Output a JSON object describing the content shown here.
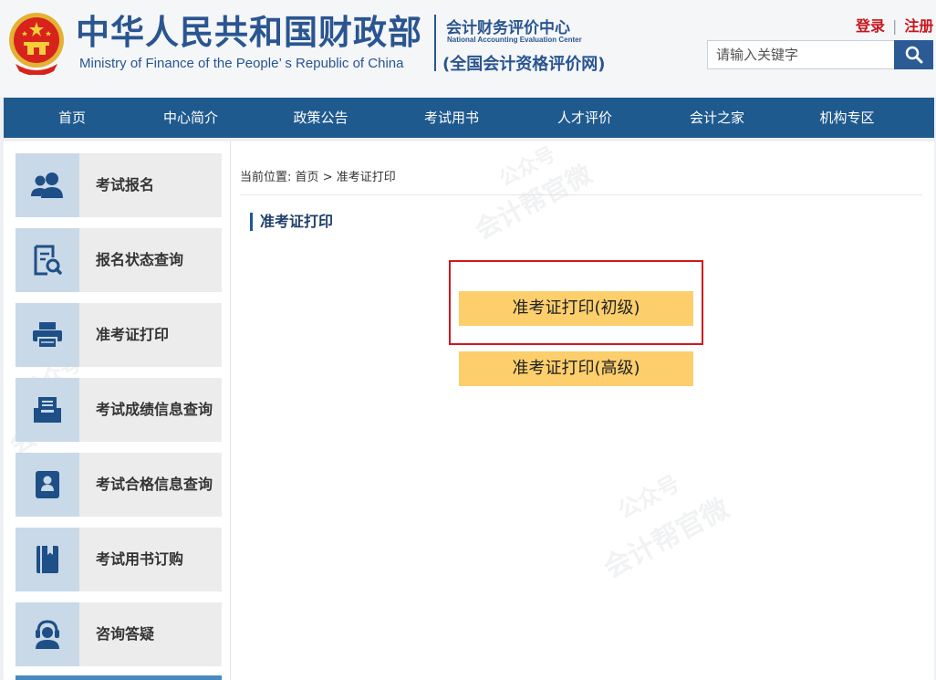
{
  "header": {
    "title_cn": "中华人民共和国财政部",
    "title_en": "Ministry of Finance of the People’ s Republic of China",
    "center_cn": "会计财务评价中心",
    "center_en": "National Accounting Evaluation Center",
    "center_net": "(全国会计资格评价网)",
    "login": "登录",
    "register": "注册",
    "search_placeholder": "请输入关键字"
  },
  "nav": [
    "首页",
    "中心简介",
    "政策公告",
    "考试用书",
    "人才评价",
    "会计之家",
    "机构专区"
  ],
  "sidebar": {
    "items": [
      {
        "label": "考试报名",
        "icon": "users-icon"
      },
      {
        "label": "报名状态查询",
        "icon": "document-search-icon"
      },
      {
        "label": "准考证打印",
        "icon": "printer-icon"
      },
      {
        "label": "考试成绩信息查询",
        "icon": "inbox-icon"
      },
      {
        "label": "考试合格信息查询",
        "icon": "certificate-icon"
      },
      {
        "label": "考试用书订购",
        "icon": "book-icon"
      },
      {
        "label": "咨询答疑",
        "icon": "headset-icon"
      }
    ]
  },
  "breadcrumb": {
    "prefix": "当前位置:",
    "home": "首页",
    "separator": ">",
    "current": "准考证打印"
  },
  "section_title": "准考证打印",
  "buttons": {
    "primary": "准考证打印(初级)",
    "advanced": "准考证打印(高级)"
  },
  "watermark": {
    "line1": "公众号",
    "line2": "会计帮官微"
  },
  "colors": {
    "brand_blue": "#2a5590",
    "nav_blue": "#1f5a8f",
    "button_yellow": "#fccf6c",
    "highlight_red": "#d4161d",
    "auth_red": "#c8161d"
  }
}
